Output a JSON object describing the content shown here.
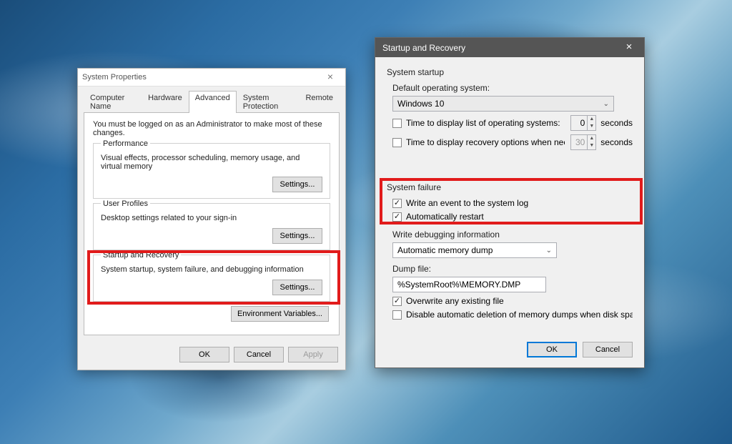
{
  "sp": {
    "title": "System Properties",
    "tabs": [
      "Computer Name",
      "Hardware",
      "Advanced",
      "System Protection",
      "Remote"
    ],
    "active_tab": 2,
    "note": "You must be logged on as an Administrator to make most of these changes.",
    "groups": {
      "performance": {
        "label": "Performance",
        "desc": "Visual effects, processor scheduling, memory usage, and virtual memory",
        "btn": "Settings..."
      },
      "profiles": {
        "label": "User Profiles",
        "desc": "Desktop settings related to your sign-in",
        "btn": "Settings..."
      },
      "startup": {
        "label": "Startup and Recovery",
        "desc": "System startup, system failure, and debugging information",
        "btn": "Settings..."
      }
    },
    "env_btn": "Environment Variables...",
    "ok": "OK",
    "cancel": "Cancel",
    "apply": "Apply"
  },
  "sr": {
    "title": "Startup and Recovery",
    "system_startup": {
      "label": "System startup",
      "default_os_label": "Default operating system:",
      "default_os": "Windows 10",
      "time_list_label": "Time to display list of operating systems:",
      "time_list_value": "0",
      "time_recovery_label": "Time to display recovery options when needed:",
      "time_recovery_value": "30",
      "seconds": "seconds"
    },
    "system_failure": {
      "label": "System failure",
      "write_event": "Write an event to the system log",
      "auto_restart": "Automatically restart"
    },
    "debug": {
      "label": "Write debugging information",
      "type": "Automatic memory dump",
      "dump_file_label": "Dump file:",
      "dump_file": "%SystemRoot%\\MEMORY.DMP",
      "overwrite": "Overwrite any existing file",
      "disable_delete": "Disable automatic deletion of memory dumps when disk space is low"
    },
    "ok": "OK",
    "cancel": "Cancel"
  }
}
